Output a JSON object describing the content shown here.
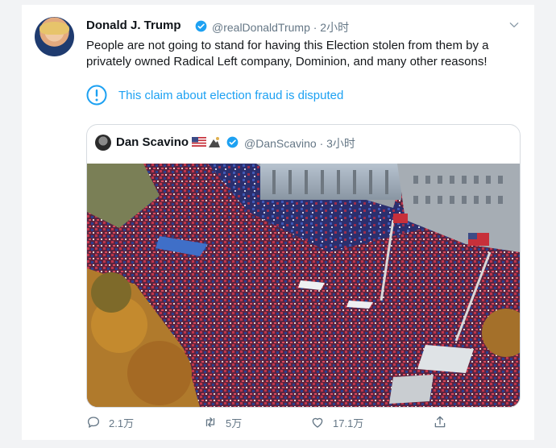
{
  "tweet": {
    "author_name": "Donald J. Trump",
    "handle_time": "@realDonaldTrump · 2小时",
    "text": "People are not going to stand for having this Election stolen from them by a privately owned Radical Left company, Dominion, and many other reasons!",
    "notice": "This claim about election fraud is disputed"
  },
  "quoted": {
    "author_name": "Dan Scavino",
    "handle_time": "@DanScavino · 3小时"
  },
  "actions": {
    "reply_count": "2.1万",
    "retweet_count": "5万",
    "like_count": "17.1万"
  },
  "colors": {
    "accent": "#1da1f2",
    "muted": "#657786"
  },
  "icons": [
    "verified-badge-icon",
    "chevron-down-icon",
    "alert-circle-icon",
    "reply-icon",
    "retweet-icon",
    "like-icon",
    "share-icon"
  ]
}
